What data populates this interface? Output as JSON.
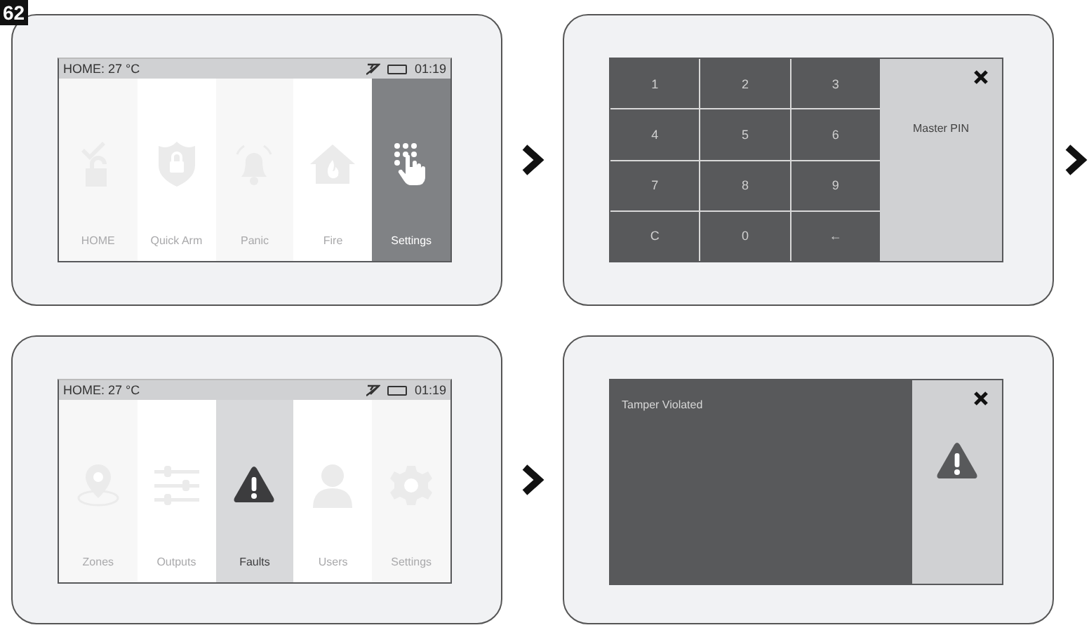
{
  "figure_number": "62",
  "panels": [
    {
      "kind": "dark_menu",
      "status": {
        "location": "HOME: 27 °C",
        "time": "01:19"
      },
      "tiles": [
        {
          "label": "HOME",
          "kind": "lock",
          "selected": false
        },
        {
          "label": "Quick Arm",
          "kind": "shield",
          "selected": false
        },
        {
          "label": "Panic",
          "kind": "bell",
          "selected": false
        },
        {
          "label": "Fire",
          "kind": "house",
          "selected": false
        },
        {
          "label": "Settings",
          "kind": "keypad",
          "selected": true
        }
      ]
    },
    {
      "kind": "keypad",
      "keys": [
        "1",
        "2",
        "3",
        "4",
        "5",
        "6",
        "7",
        "8",
        "9",
        "C",
        "0",
        "←"
      ],
      "prompt": "Master PIN"
    },
    {
      "kind": "light_menu",
      "status": {
        "location": "HOME: 27 °C",
        "time": "01:19"
      },
      "tiles": [
        {
          "label": "Zones",
          "kind": "pin",
          "selected": false
        },
        {
          "label": "Outputs",
          "kind": "sliders",
          "selected": false
        },
        {
          "label": "Faults",
          "kind": "warning",
          "selected": true
        },
        {
          "label": "Users",
          "kind": "user",
          "selected": false
        },
        {
          "label": "Settings",
          "kind": "gear",
          "selected": false
        }
      ]
    },
    {
      "kind": "alert",
      "message": "Tamper Violated"
    }
  ]
}
